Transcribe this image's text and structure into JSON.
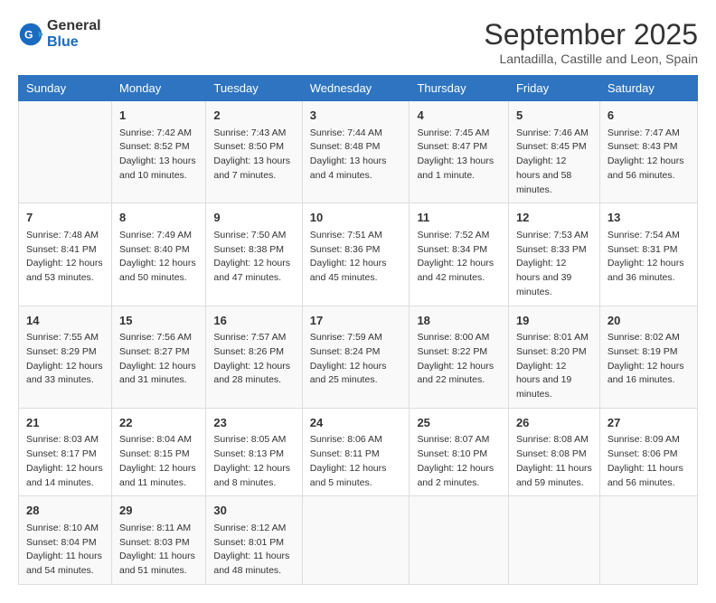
{
  "logo": {
    "general": "General",
    "blue": "Blue"
  },
  "title": "September 2025",
  "subtitle": "Lantadilla, Castille and Leon, Spain",
  "days_of_week": [
    "Sunday",
    "Monday",
    "Tuesday",
    "Wednesday",
    "Thursday",
    "Friday",
    "Saturday"
  ],
  "weeks": [
    [
      {
        "day": "",
        "sunrise": "",
        "sunset": "",
        "daylight": ""
      },
      {
        "day": "1",
        "sunrise": "Sunrise: 7:42 AM",
        "sunset": "Sunset: 8:52 PM",
        "daylight": "Daylight: 13 hours and 10 minutes."
      },
      {
        "day": "2",
        "sunrise": "Sunrise: 7:43 AM",
        "sunset": "Sunset: 8:50 PM",
        "daylight": "Daylight: 13 hours and 7 minutes."
      },
      {
        "day": "3",
        "sunrise": "Sunrise: 7:44 AM",
        "sunset": "Sunset: 8:48 PM",
        "daylight": "Daylight: 13 hours and 4 minutes."
      },
      {
        "day": "4",
        "sunrise": "Sunrise: 7:45 AM",
        "sunset": "Sunset: 8:47 PM",
        "daylight": "Daylight: 13 hours and 1 minute."
      },
      {
        "day": "5",
        "sunrise": "Sunrise: 7:46 AM",
        "sunset": "Sunset: 8:45 PM",
        "daylight": "Daylight: 12 hours and 58 minutes."
      },
      {
        "day": "6",
        "sunrise": "Sunrise: 7:47 AM",
        "sunset": "Sunset: 8:43 PM",
        "daylight": "Daylight: 12 hours and 56 minutes."
      }
    ],
    [
      {
        "day": "7",
        "sunrise": "Sunrise: 7:48 AM",
        "sunset": "Sunset: 8:41 PM",
        "daylight": "Daylight: 12 hours and 53 minutes."
      },
      {
        "day": "8",
        "sunrise": "Sunrise: 7:49 AM",
        "sunset": "Sunset: 8:40 PM",
        "daylight": "Daylight: 12 hours and 50 minutes."
      },
      {
        "day": "9",
        "sunrise": "Sunrise: 7:50 AM",
        "sunset": "Sunset: 8:38 PM",
        "daylight": "Daylight: 12 hours and 47 minutes."
      },
      {
        "day": "10",
        "sunrise": "Sunrise: 7:51 AM",
        "sunset": "Sunset: 8:36 PM",
        "daylight": "Daylight: 12 hours and 45 minutes."
      },
      {
        "day": "11",
        "sunrise": "Sunrise: 7:52 AM",
        "sunset": "Sunset: 8:34 PM",
        "daylight": "Daylight: 12 hours and 42 minutes."
      },
      {
        "day": "12",
        "sunrise": "Sunrise: 7:53 AM",
        "sunset": "Sunset: 8:33 PM",
        "daylight": "Daylight: 12 hours and 39 minutes."
      },
      {
        "day": "13",
        "sunrise": "Sunrise: 7:54 AM",
        "sunset": "Sunset: 8:31 PM",
        "daylight": "Daylight: 12 hours and 36 minutes."
      }
    ],
    [
      {
        "day": "14",
        "sunrise": "Sunrise: 7:55 AM",
        "sunset": "Sunset: 8:29 PM",
        "daylight": "Daylight: 12 hours and 33 minutes."
      },
      {
        "day": "15",
        "sunrise": "Sunrise: 7:56 AM",
        "sunset": "Sunset: 8:27 PM",
        "daylight": "Daylight: 12 hours and 31 minutes."
      },
      {
        "day": "16",
        "sunrise": "Sunrise: 7:57 AM",
        "sunset": "Sunset: 8:26 PM",
        "daylight": "Daylight: 12 hours and 28 minutes."
      },
      {
        "day": "17",
        "sunrise": "Sunrise: 7:59 AM",
        "sunset": "Sunset: 8:24 PM",
        "daylight": "Daylight: 12 hours and 25 minutes."
      },
      {
        "day": "18",
        "sunrise": "Sunrise: 8:00 AM",
        "sunset": "Sunset: 8:22 PM",
        "daylight": "Daylight: 12 hours and 22 minutes."
      },
      {
        "day": "19",
        "sunrise": "Sunrise: 8:01 AM",
        "sunset": "Sunset: 8:20 PM",
        "daylight": "Daylight: 12 hours and 19 minutes."
      },
      {
        "day": "20",
        "sunrise": "Sunrise: 8:02 AM",
        "sunset": "Sunset: 8:19 PM",
        "daylight": "Daylight: 12 hours and 16 minutes."
      }
    ],
    [
      {
        "day": "21",
        "sunrise": "Sunrise: 8:03 AM",
        "sunset": "Sunset: 8:17 PM",
        "daylight": "Daylight: 12 hours and 14 minutes."
      },
      {
        "day": "22",
        "sunrise": "Sunrise: 8:04 AM",
        "sunset": "Sunset: 8:15 PM",
        "daylight": "Daylight: 12 hours and 11 minutes."
      },
      {
        "day": "23",
        "sunrise": "Sunrise: 8:05 AM",
        "sunset": "Sunset: 8:13 PM",
        "daylight": "Daylight: 12 hours and 8 minutes."
      },
      {
        "day": "24",
        "sunrise": "Sunrise: 8:06 AM",
        "sunset": "Sunset: 8:11 PM",
        "daylight": "Daylight: 12 hours and 5 minutes."
      },
      {
        "day": "25",
        "sunrise": "Sunrise: 8:07 AM",
        "sunset": "Sunset: 8:10 PM",
        "daylight": "Daylight: 12 hours and 2 minutes."
      },
      {
        "day": "26",
        "sunrise": "Sunrise: 8:08 AM",
        "sunset": "Sunset: 8:08 PM",
        "daylight": "Daylight: 11 hours and 59 minutes."
      },
      {
        "day": "27",
        "sunrise": "Sunrise: 8:09 AM",
        "sunset": "Sunset: 8:06 PM",
        "daylight": "Daylight: 11 hours and 56 minutes."
      }
    ],
    [
      {
        "day": "28",
        "sunrise": "Sunrise: 8:10 AM",
        "sunset": "Sunset: 8:04 PM",
        "daylight": "Daylight: 11 hours and 54 minutes."
      },
      {
        "day": "29",
        "sunrise": "Sunrise: 8:11 AM",
        "sunset": "Sunset: 8:03 PM",
        "daylight": "Daylight: 11 hours and 51 minutes."
      },
      {
        "day": "30",
        "sunrise": "Sunrise: 8:12 AM",
        "sunset": "Sunset: 8:01 PM",
        "daylight": "Daylight: 11 hours and 48 minutes."
      },
      {
        "day": "",
        "sunrise": "",
        "sunset": "",
        "daylight": ""
      },
      {
        "day": "",
        "sunrise": "",
        "sunset": "",
        "daylight": ""
      },
      {
        "day": "",
        "sunrise": "",
        "sunset": "",
        "daylight": ""
      },
      {
        "day": "",
        "sunrise": "",
        "sunset": "",
        "daylight": ""
      }
    ]
  ]
}
